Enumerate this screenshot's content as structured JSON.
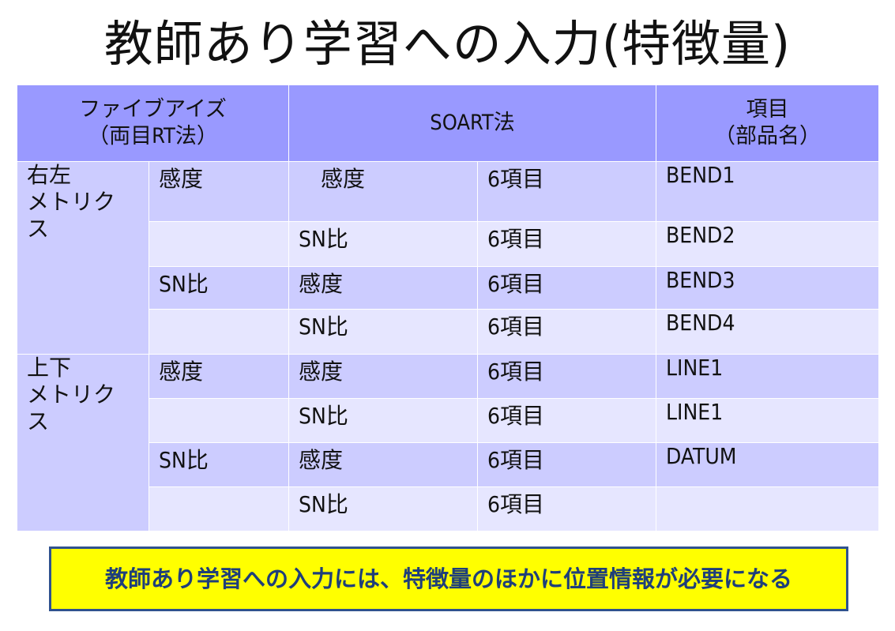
{
  "title": "教師あり学習への入力(特徴量)",
  "header": {
    "five_eyes": "ファイブアイズ",
    "five_eyes_sub": "（両目RT法）",
    "soart": "SOART法",
    "item": "項目",
    "item_sub": "（部品名）"
  },
  "groups": [
    {
      "label": [
        "右左",
        "メトリク",
        "ス"
      ]
    },
    {
      "label": [
        "上下",
        "メトリク",
        "ス"
      ]
    }
  ],
  "rows": [
    {
      "five": "感度",
      "soart": "　感度",
      "count": "6項目",
      "item": "BEND1"
    },
    {
      "five": "",
      "soart": "SN比",
      "count": "6項目",
      "item": "BEND2"
    },
    {
      "five": "SN比",
      "soart": "感度",
      "count": "6項目",
      "item": "BEND3"
    },
    {
      "five": "",
      "soart": "SN比",
      "count": "6項目",
      "item": "BEND4"
    },
    {
      "five": "感度",
      "soart": "感度",
      "count": "6項目",
      "item": "LINE1"
    },
    {
      "five": "",
      "soart": "SN比",
      "count": "6項目",
      "item": "LINE1"
    },
    {
      "five": "SN比",
      "soart": "感度",
      "count": "6項目",
      "item": "DATUM"
    },
    {
      "five": "",
      "soart": "SN比",
      "count": "6項目",
      "item": ""
    }
  ],
  "note": "教師あり学習への入力には、特徴量のほかに位置情報が必要になる",
  "colors": {
    "header": "#9999ff",
    "row_dark": "#ccccff",
    "row_light": "#e6e6ff",
    "count_text": "#e60000",
    "note_bg": "#ffff00"
  }
}
